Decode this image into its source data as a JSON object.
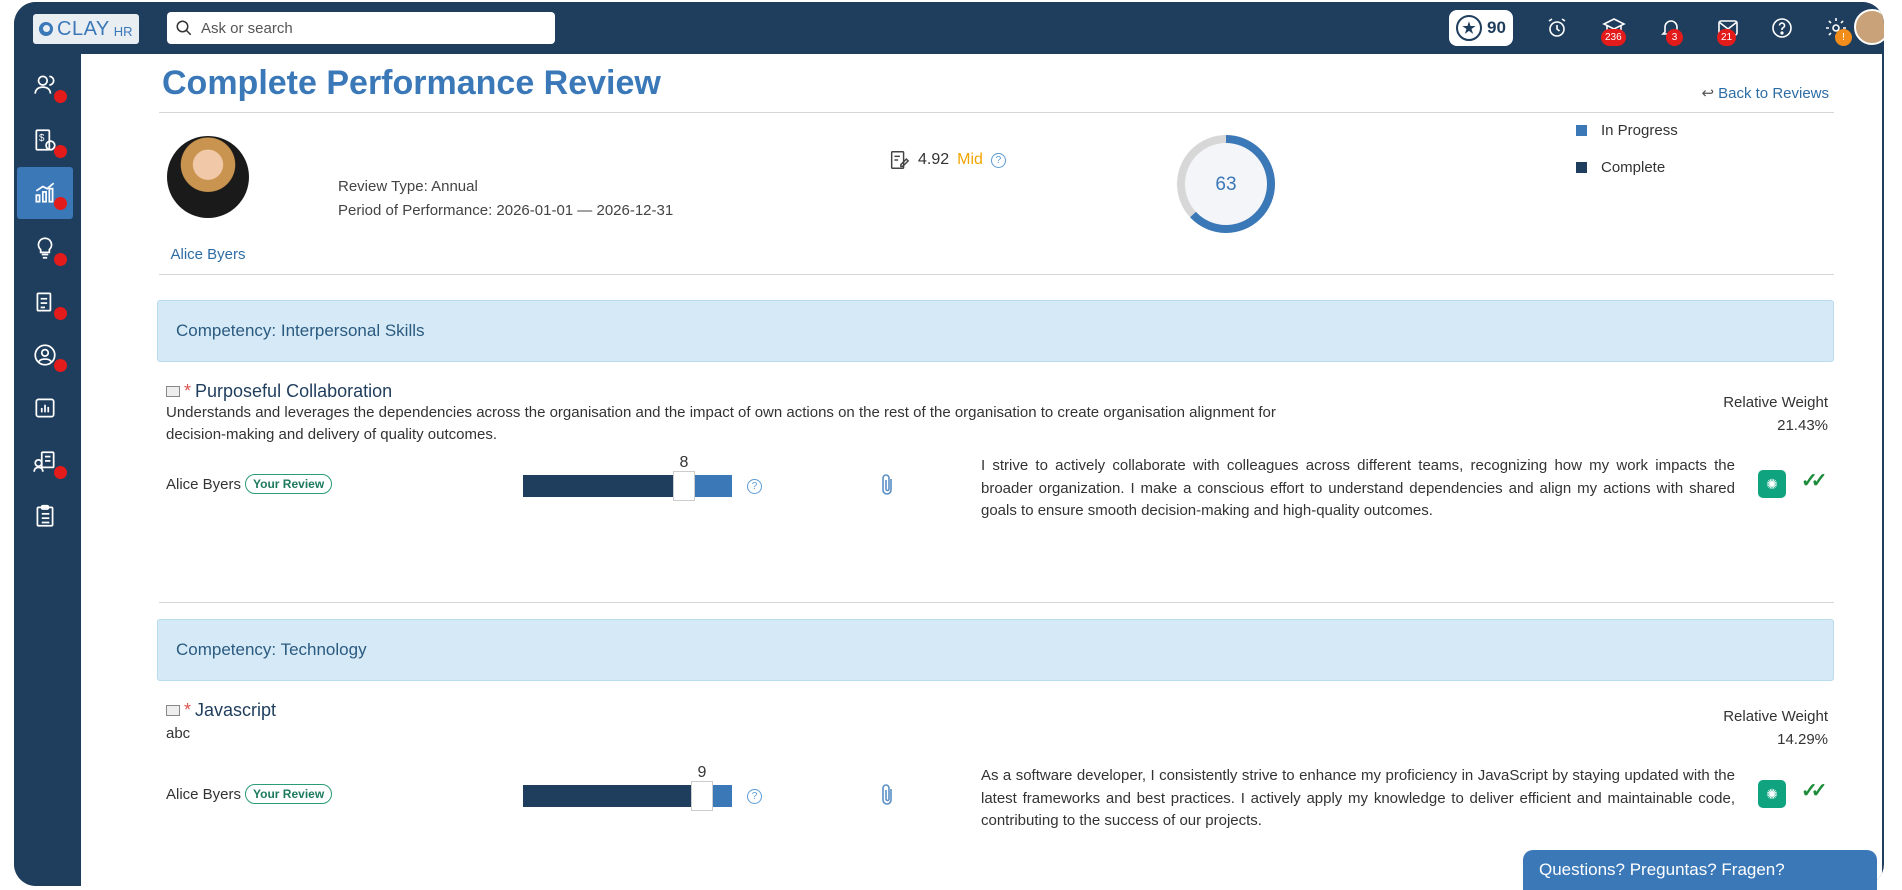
{
  "app": {
    "brand": "CLAY",
    "brand_suffix": "HR"
  },
  "search": {
    "placeholder": "Ask or search"
  },
  "topbar": {
    "points": "90",
    "badges": {
      "courses": "236",
      "notifications": "3",
      "mail": "21",
      "settings": "!"
    }
  },
  "page": {
    "title": "Complete Performance Review",
    "back_link": "Back to Reviews"
  },
  "employee": {
    "name": "Alice Byers",
    "review_type": "Review Type: Annual",
    "period": "Period of Performance: 2026-01-01 — 2026-12-31",
    "score": "4.92",
    "score_label": "Mid"
  },
  "progress": {
    "value": "63",
    "fraction": 0.63,
    "legend_in_progress": "In Progress",
    "legend_complete": "Complete"
  },
  "colors": {
    "primary": "#1f3d5c",
    "accent": "#3a78b8",
    "mid": "#f0a500",
    "success": "#1e8c3a",
    "competency_bg": "#d5eaf6"
  },
  "competencies": [
    {
      "title": "Competency: Interpersonal Skills",
      "kpi": {
        "name": "Purposeful Collaboration",
        "description": "Understands and leverages the dependencies across the organisation and the impact of own actions on the rest of the organisation to create organisation alignment for decision-making and delivery of quality outcomes.",
        "weight_label": "Relative Weight",
        "weight": "21.43%",
        "reviewer": "Alice Byers",
        "reviewer_tag": "Your Review",
        "rating": "8",
        "rating_fraction": 0.8,
        "comment": "I strive to actively collaborate with colleagues across different teams, recognizing how my work impacts the broader organization. I make a conscious effort to understand dependencies and align my actions with shared goals to ensure smooth decision-making and high-quality outcomes."
      }
    },
    {
      "title": "Competency: Technology",
      "kpi": {
        "name": "Javascript",
        "description": "abc",
        "weight_label": "Relative Weight",
        "weight": "14.29%",
        "reviewer": "Alice Byers",
        "reviewer_tag": "Your Review",
        "rating": "9",
        "rating_fraction": 0.9,
        "comment": "As a software developer, I consistently strive to enhance my proficiency in JavaScript by staying updated with the latest frameworks and best practices. I actively apply my knowledge to deliver efficient and maintainable code, contributing to the success of our projects."
      }
    }
  ],
  "chat": {
    "label": "Questions? Preguntas? Fragen?"
  },
  "icons": {
    "sidebar": [
      "people-icon",
      "payroll-icon",
      "performance-chart-icon",
      "learning-bulb-icon",
      "documents-icon",
      "profile-icon",
      "reports-icon",
      "recruiting-icon",
      "checklist-icon"
    ],
    "topbar": [
      "star-icon",
      "alarm-icon",
      "courses-icon",
      "bell-icon",
      "mail-icon",
      "help-icon",
      "gear-icon"
    ]
  }
}
